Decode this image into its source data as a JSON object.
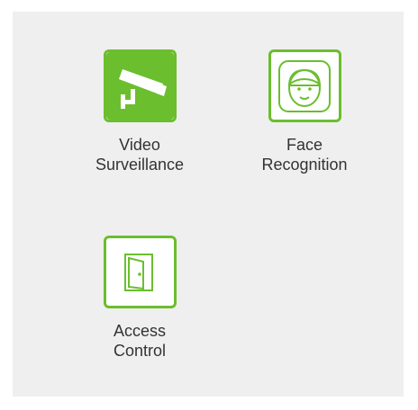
{
  "tiles": [
    {
      "id": "video-surveillance",
      "label_line1": "Video",
      "label_line2": "Surveillance",
      "icon": "cctv-camera-icon"
    },
    {
      "id": "face-recognition",
      "label_line1": "Face",
      "label_line2": "Recognition",
      "icon": "face-icon"
    },
    {
      "id": "access-control",
      "label_line1": "Access",
      "label_line2": "Control",
      "icon": "door-icon"
    }
  ],
  "colors": {
    "accent": "#6bbe2e",
    "panel_background": "#efefef",
    "text": "#333333"
  }
}
